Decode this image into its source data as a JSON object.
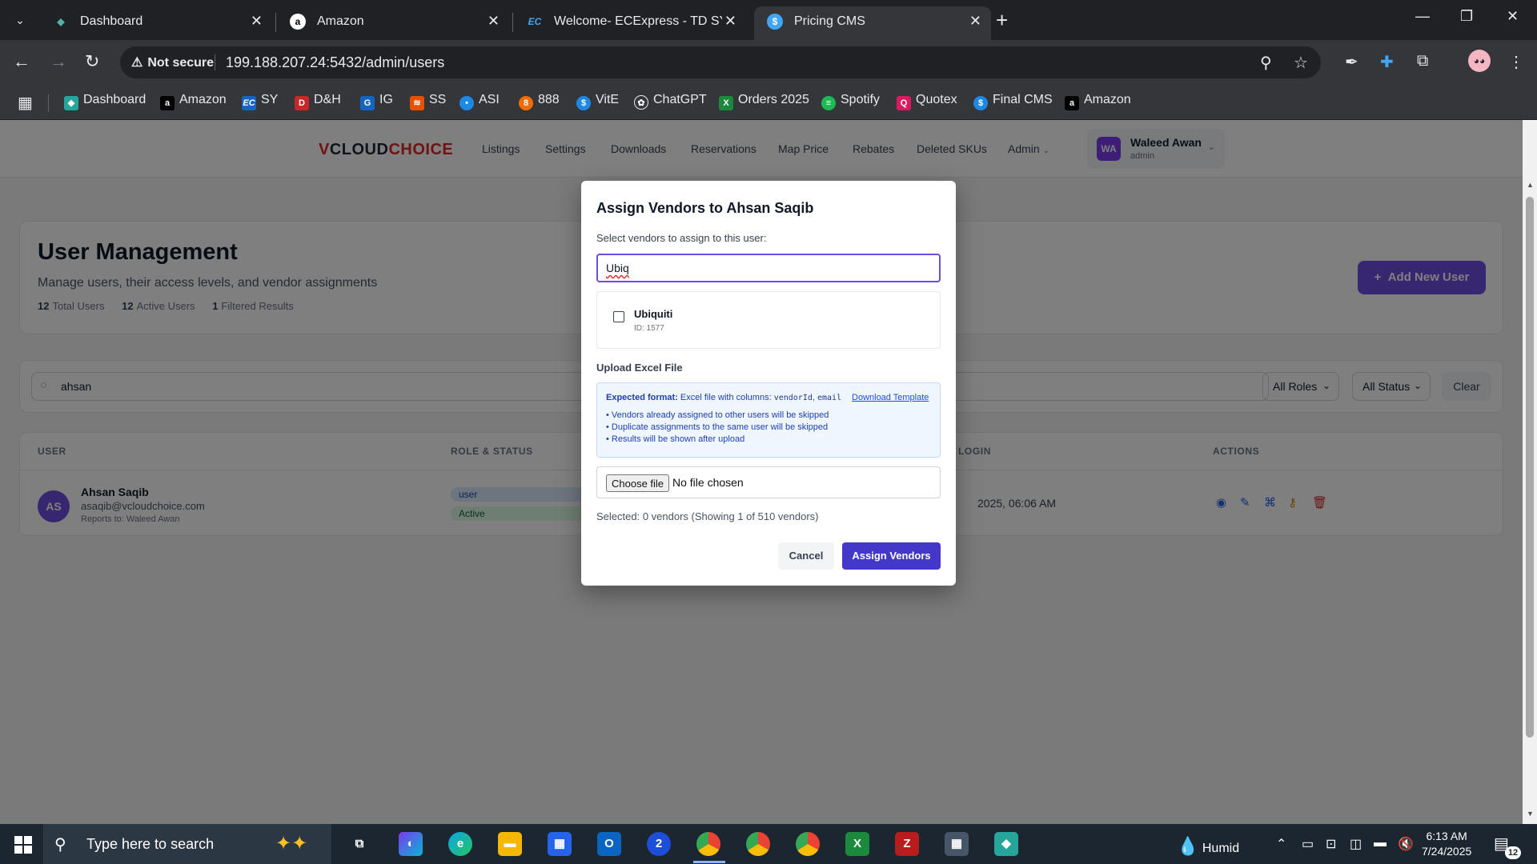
{
  "browser": {
    "tabs": [
      {
        "title": "Dashboard",
        "icon": "teal-diamond-icon",
        "active": false
      },
      {
        "title": "Amazon",
        "icon": "amazon-icon",
        "active": false
      },
      {
        "title": "Welcome- ECExpress - TD SYNN",
        "icon": "ec-icon",
        "active": false
      },
      {
        "title": "Pricing CMS",
        "icon": "dollar-icon",
        "active": true
      }
    ],
    "security_label": "Not secure",
    "url": "199.188.207.24:5432/admin/users",
    "bookmarks": [
      {
        "label": "Dashboard",
        "icon": "teal-diamond-icon",
        "color": "#26a69a"
      },
      {
        "label": "Amazon",
        "icon": "amazon-icon",
        "color": "#000000"
      },
      {
        "label": "SY",
        "icon": "ec-icon",
        "color": "#1565c0"
      },
      {
        "label": "D&H",
        "icon": "dh-icon",
        "color": "#c62828"
      },
      {
        "label": "IG",
        "icon": "ig-icon",
        "color": "#1565c0"
      },
      {
        "label": "SS",
        "icon": "ss-icon",
        "color": "#e65100"
      },
      {
        "label": "ASI",
        "icon": "asi-icon",
        "color": "#1e88e5"
      },
      {
        "label": "888",
        "icon": "888-icon",
        "color": "#ef6c00"
      },
      {
        "label": "VitE",
        "icon": "dollar-icon",
        "color": "#1e88e5"
      },
      {
        "label": "ChatGPT",
        "icon": "chatgpt-icon",
        "color": "#35363a"
      },
      {
        "label": "Orders 2025",
        "icon": "excel-icon",
        "color": "#1b8a3c"
      },
      {
        "label": "Spotify",
        "icon": "spotify-icon",
        "color": "#1db954"
      },
      {
        "label": "Quotex",
        "icon": "quotex-icon",
        "color": "#d81b60"
      },
      {
        "label": "Final CMS",
        "icon": "dollar-icon",
        "color": "#1e88e5"
      },
      {
        "label": "Amazon",
        "icon": "amazon-icon",
        "color": "#000000"
      }
    ]
  },
  "app": {
    "logo": {
      "v": "V",
      "cloud": "CLOUD",
      "choice": "CHOICE"
    },
    "nav": [
      "Listings",
      "Settings",
      "Downloads",
      "Reservations",
      "Map Price",
      "Rebates",
      "Deleted SKUs",
      "Admin"
    ],
    "user": {
      "initials": "WA",
      "name": "Waleed Awan",
      "role": "admin"
    },
    "header": {
      "title": "User Management",
      "subtitle": "Manage users, their access levels, and vendor assignments",
      "total_users_count": "12",
      "total_users_label": "Total Users",
      "active_users_count": "12",
      "active_users_label": "Active Users",
      "filtered_count": "1",
      "filtered_label": "Filtered Results",
      "add_button": "Add New User"
    },
    "filters": {
      "search_value": "ahsan",
      "role_select": "All Roles",
      "status_select": "All Status",
      "clear_button": "Clear"
    },
    "table": {
      "columns": {
        "user": "USER",
        "role_status": "ROLE & STATUS",
        "last_login": "LOGIN",
        "actions": "ACTIONS"
      },
      "rows": [
        {
          "initials": "AS",
          "name": "Ahsan Saqib",
          "email": "asaqib@vcloudchoice.com",
          "reports_to": "Reports to: Waleed Awan",
          "role": "user",
          "status": "Active",
          "last_login": "2025, 06:06 AM"
        }
      ]
    }
  },
  "modal": {
    "title": "Assign Vendors to Ahsan Saqib",
    "subtitle": "Select vendors to assign to this user:",
    "search_value": "Ubiq",
    "vendors": [
      {
        "name": "Ubiquiti",
        "id": "ID: 1577",
        "checked": false
      }
    ],
    "upload_label": "Upload Excel File",
    "info": {
      "expected_label": "Expected format:",
      "expected_text": "Excel file with columns:",
      "col1": "vendorId",
      "sep": ",",
      "col2": "email",
      "download_link": "Download Template",
      "bullets": [
        "• Vendors already assigned to other users will be skipped",
        "• Duplicate assignments to the same user will be skipped",
        "• Results will be shown after upload"
      ]
    },
    "file": {
      "button": "Choose file",
      "status": "No file chosen"
    },
    "selection_summary": "Selected: 0 vendors  (Showing 1 of 510 vendors)",
    "cancel_button": "Cancel",
    "assign_button": "Assign Vendors"
  },
  "taskbar": {
    "search_placeholder": "Type here to search",
    "weather": "Humid",
    "time": "6:13 AM",
    "date": "7/24/2025",
    "notification_count": "12"
  }
}
